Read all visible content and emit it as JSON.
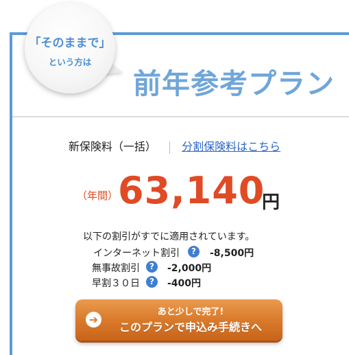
{
  "header": {
    "bubble_line1": "「そのままで」",
    "bubble_line2": "という方は",
    "plan_title": "前年参考プラン"
  },
  "premium": {
    "label": "新保険料（一括）",
    "installment_link": "分割保険料はこちら"
  },
  "price": {
    "annual_label": "（年間）",
    "amount": "63,140",
    "unit": "円"
  },
  "discounts": {
    "intro": "以下の割引がすでに適用されています。",
    "items": [
      {
        "name": "インターネット割引",
        "help": "?",
        "amount": "-8,500円"
      },
      {
        "name": "無事故割引",
        "help": "?",
        "amount": "-2,000円"
      },
      {
        "name": "早割３０日",
        "help": "?",
        "amount": "-400円"
      }
    ]
  },
  "cta": {
    "small_text": "あと少しで完了!",
    "main_text": "このプランで申込み手続きへ",
    "arrow": "➔"
  },
  "colors": {
    "border": "#5b9ad9",
    "title": "#6fa6da",
    "price": "#e04a24",
    "link": "#2a66c8",
    "help_icon": "#3f7fd0",
    "button": "#d97a2b"
  }
}
